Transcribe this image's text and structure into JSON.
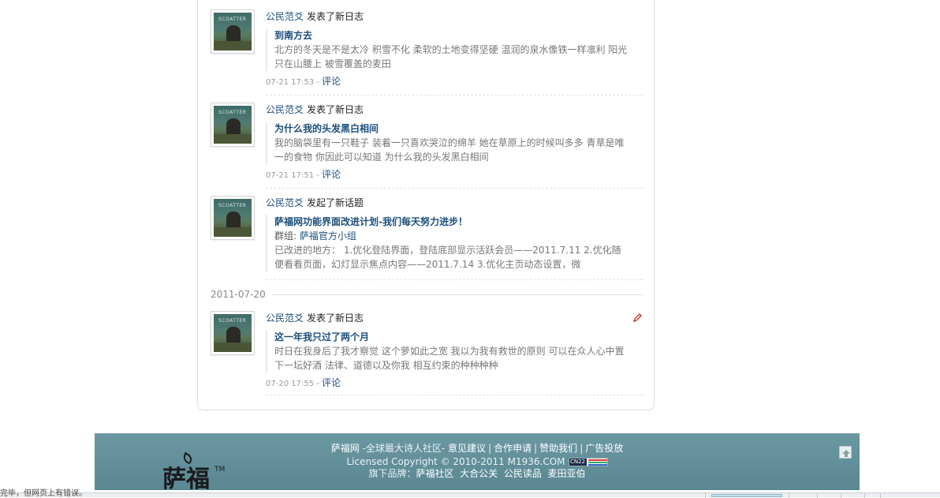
{
  "feed": {
    "items": [
      {
        "user": "公民范爻",
        "action": "发表了新日志",
        "title": "到南方去",
        "excerpt_line1": "北方的冬天是不是太冷  积雪不化  柔软的土地变得坚硬  温润的泉水像铁一样凛利  阳光",
        "excerpt_line2": "只在山腰上  被雪覆盖的麦田",
        "time": "07-21 17:53",
        "comment_label": "评论"
      },
      {
        "user": "公民范爻",
        "action": "发表了新日志",
        "title": "为什么我的头发黑白相间",
        "excerpt_line1": "我的脑袋里有一只鞋子  装着一只喜欢哭泣的绵羊  她在草原上的时候叫多多  青草是唯",
        "excerpt_line2": "一的食物  你因此可以知道  为什么我的头发黑白相间",
        "time": "07-21 17:51",
        "comment_label": "评论"
      },
      {
        "user": "公民范爻",
        "action": "发起了新话题",
        "title": "萨福网功能界面改进计划-我们每天努力进步！",
        "group_prefix": "群组: ",
        "group_name": "萨福官方小组",
        "excerpt_line1": "已改进的地方：  1.优化登陆界面，登陆底部显示活跃会员——2011.7.11 2.优化随",
        "excerpt_line2": "便看看页面，幻灯显示焦点内容——2011.7.14 3.优化主页动态设置，微"
      },
      {
        "user": "公民范爻",
        "action": "发表了新日志",
        "title": "这一年我只过了两个月",
        "excerpt_line1": "时日在我身后了我才察觉  这个萝如此之宽  我以为我有救世的原则  可以在众人心中置",
        "excerpt_line2": "下一坛好酒  法律、道德以及你我  相互约束的种种种种",
        "time": "07-20 17:55",
        "comment_label": "评论"
      }
    ],
    "date_separator": "2011-07-20",
    "avatar_caption": "SCOATTER"
  },
  "footer": {
    "site_name": "萨福网",
    "slogan": " -全球最大诗人社区- ",
    "links": [
      "意见建议",
      "合作申请",
      "赞助我们",
      "广告投放"
    ],
    "copyright": "Licensed Copyright © 2010-2011 M1936.COM",
    "cnzz_label": "CN22",
    "brands_label": "旗下品牌：",
    "brands": [
      "萨福社区",
      "大合公关",
      "公民读品",
      "麦田亚伯"
    ],
    "logo_text": "萨福",
    "logo_tm": "TM"
  },
  "statusbar": {
    "text": "完毕，但网页上有错误。"
  },
  "colors": {
    "link": "#1b4f7a",
    "footer_bg": "#5f8e9a",
    "edit_icon": "#c0392b"
  }
}
